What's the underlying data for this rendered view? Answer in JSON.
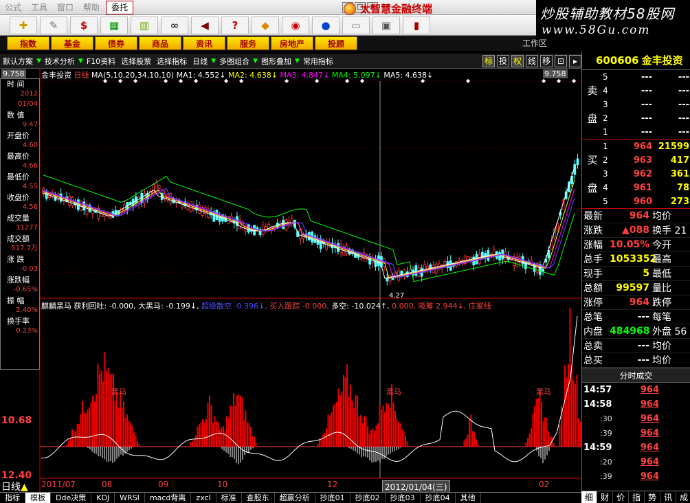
{
  "menubar": {
    "items": [
      "公式",
      "工具",
      "窗口",
      "帮助"
    ],
    "selected": "委托",
    "brand": "太智慧金融终端"
  },
  "watermark": {
    "line1": "炒股辅助教材58股网",
    "line2": "www.58Gu.com"
  },
  "categories": [
    "指数",
    "基金",
    "债券",
    "商品",
    "资讯",
    "服务",
    "房地产",
    "投顾"
  ],
  "workarea_label": "工作区",
  "tabrow": {
    "items": [
      "默认方案",
      "技术分析",
      "F10资料",
      "选择股票",
      "选择指标",
      "日线",
      "多图组合",
      "图形叠加",
      "常用指标"
    ],
    "toggles": [
      "标",
      "投",
      "权",
      "线",
      "移"
    ]
  },
  "chart_header": {
    "stock_label": "金丰投资",
    "period": "日线",
    "ma_params": "MA(5,10,20,34,10,10)",
    "ma1": "MA1: 4.552↓",
    "ma2": "MA2: 4.638↓",
    "ma3": "MA3: 4.847↓",
    "ma4": "MA4: 5.097↓",
    "ma5": "MA5: 4.638↓",
    "top_price_left": "9.758",
    "top_price_right": "9.758",
    "low_mark": "4.27"
  },
  "indicator": {
    "name": "麒麟黑马",
    "items": [
      "获利回吐: -0.000,",
      "大黑马: -0.199↓,",
      "超级散空",
      "-0.396↓,",
      "买入跟踪",
      "-0.000,",
      "多空: -10.024↑,",
      "0.000,",
      "吸筹",
      "2.944↓,",
      "庄家线"
    ],
    "label_hm": "黑马",
    "axis_top": "10.68",
    "axis_bottom": "12.40"
  },
  "info_panel": [
    {
      "label": "时  间",
      "value": "2012"
    },
    {
      "label": "",
      "value": "01/04"
    },
    {
      "label": "数  值",
      "value": "9.47"
    },
    {
      "label": "开盘价",
      "value": "4.60"
    },
    {
      "label": "最高价",
      "value": "4.66"
    },
    {
      "label": "最低价",
      "value": "4.55"
    },
    {
      "label": "收盘价",
      "value": "4.56"
    },
    {
      "label": "成交量",
      "value": "11277"
    },
    {
      "label": "成交额",
      "value": "517.7万"
    },
    {
      "label": "涨  跌",
      "value": "-0.03"
    },
    {
      "label": "涨跌幅",
      "value": "-0.65%"
    },
    {
      "label": "振  幅",
      "value": "2.40%"
    },
    {
      "label": "换手率",
      "value": "0.23%"
    }
  ],
  "quote": {
    "code": "600606",
    "name": "金丰投资",
    "sell_label_1": "卖",
    "sell_label_2": "盘",
    "buy_label_1": "买",
    "buy_label_2": "盘",
    "sell": [
      {
        "lvl": "5",
        "price": "---",
        "vol": "---"
      },
      {
        "lvl": "4",
        "price": "---",
        "vol": "---"
      },
      {
        "lvl": "3",
        "price": "---",
        "vol": "---"
      },
      {
        "lvl": "2",
        "price": "---",
        "vol": "---"
      },
      {
        "lvl": "1",
        "price": "---",
        "vol": "---"
      }
    ],
    "buy": [
      {
        "lvl": "1",
        "price": "964",
        "vol": "21599"
      },
      {
        "lvl": "2",
        "price": "963",
        "vol": "417"
      },
      {
        "lvl": "3",
        "price": "962",
        "vol": "361"
      },
      {
        "lvl": "4",
        "price": "961",
        "vol": "78"
      },
      {
        "lvl": "5",
        "price": "960",
        "vol": "273"
      }
    ],
    "summary": [
      {
        "k": "最新",
        "v": "964",
        "k2": "均价",
        "color": "#ff4040"
      },
      {
        "k": "涨跌",
        "v": "▲088",
        "k2": "换手 21",
        "color": "#ff4040"
      },
      {
        "k": "涨幅",
        "v": "10.05%",
        "k2": "今开",
        "color": "#ff4040"
      },
      {
        "k": "总手",
        "v": "1053352",
        "k2": "最高",
        "color": "#ffff00"
      },
      {
        "k": "现手",
        "v": "5",
        "k2": "最低",
        "color": "#ffff00"
      },
      {
        "k": "总额",
        "v": "99597",
        "k2": "量比",
        "color": "#ffff00"
      },
      {
        "k": "涨停",
        "v": "964",
        "k2": "跌停",
        "color": "#ff4040"
      },
      {
        "k": "总笔",
        "v": "---",
        "k2": "每笔",
        "color": "#ffffff"
      },
      {
        "k": "内盘",
        "v": "484968",
        "k2": "外盘 56",
        "color": "#00ff00"
      },
      {
        "k": "总卖",
        "v": "---",
        "k2": "均价",
        "color": "#ffffff"
      },
      {
        "k": "总买",
        "v": "---",
        "k2": "均价",
        "color": "#ffffff"
      }
    ],
    "ticks_title": "分时成交",
    "ticks": [
      {
        "time": "14:57",
        "price": "964",
        "sub": false
      },
      {
        "time": "14:58",
        "price": "964",
        "sub": false
      },
      {
        "time": ":30",
        "price": "964",
        "sub": true
      },
      {
        "time": ":39",
        "price": "964",
        "sub": true
      },
      {
        "time": "14:59",
        "price": "964",
        "sub": false
      },
      {
        "time": ":20",
        "price": "964",
        "sub": true
      },
      {
        "time": ":39",
        "price": "964",
        "sub": true
      }
    ]
  },
  "date_axis": {
    "labels": [
      "2011/07",
      "08",
      "09",
      "10",
      "12",
      "02"
    ],
    "highlight": "2012/01/04(三)",
    "timeframe": "日线"
  },
  "bottom_tabs": [
    "指标",
    "模板",
    "Dde决策",
    "KDJ",
    "WRSI",
    "macd背离",
    "zxcl",
    "标准",
    "查股东",
    "超赢分析",
    "抄底01",
    "抄底02",
    "抄底03",
    "抄底04",
    "其他"
  ],
  "right_bottom_tabs": [
    "细",
    "财",
    "价",
    "指",
    "势",
    "讯",
    "成"
  ],
  "chart_data": {
    "type": "candlestick",
    "price_range": [
      4.27,
      9.758
    ],
    "candles": [],
    "note": ""
  }
}
